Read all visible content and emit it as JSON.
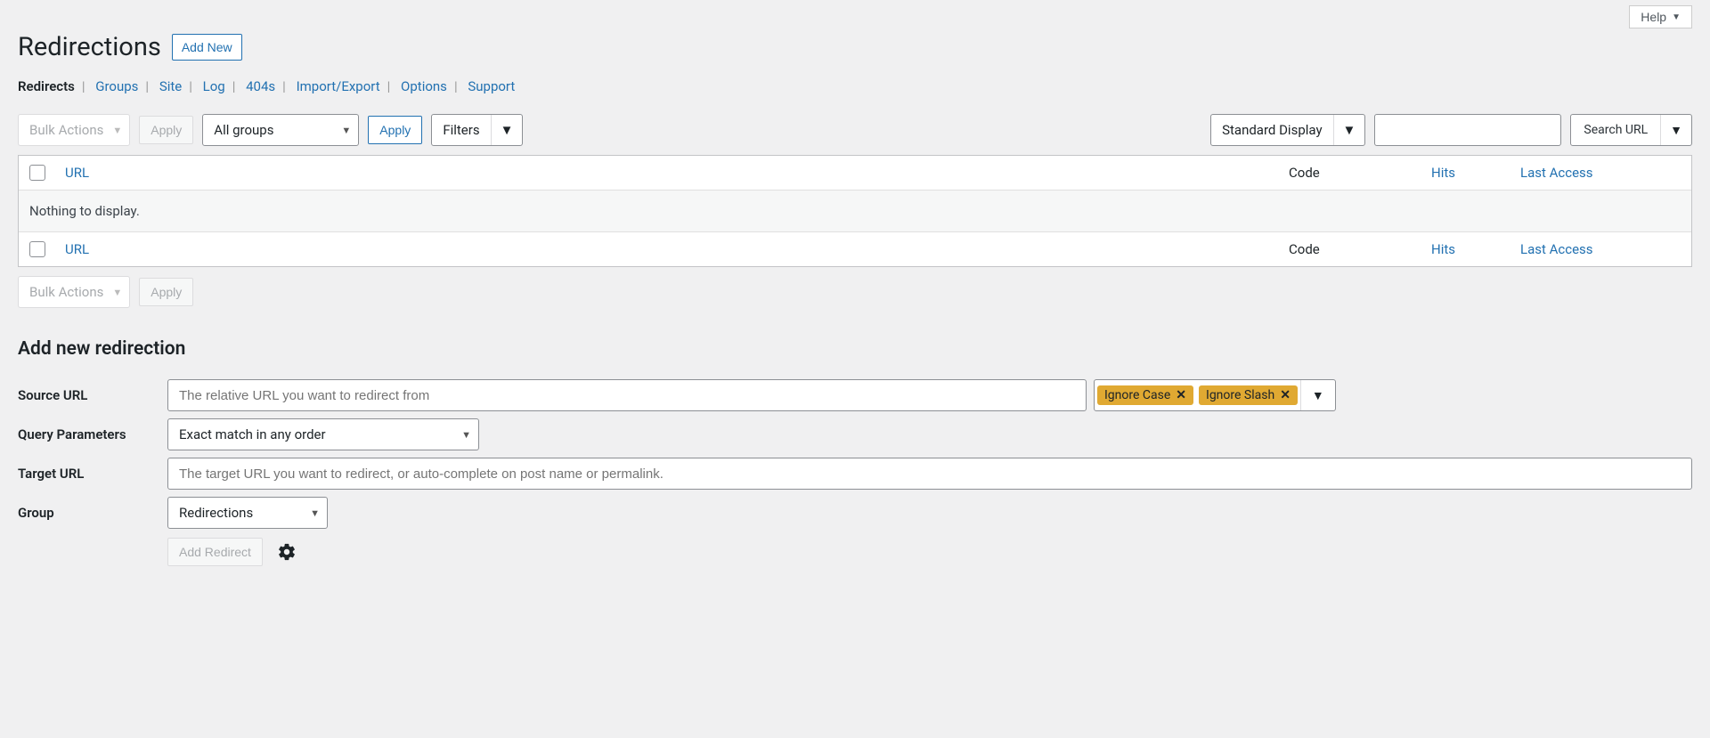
{
  "header": {
    "help_label": "Help",
    "page_title": "Redirections",
    "add_new_label": "Add New"
  },
  "nav": {
    "tabs": [
      "Redirects",
      "Groups",
      "Site",
      "Log",
      "404s",
      "Import/Export",
      "Options",
      "Support"
    ],
    "active": "Redirects"
  },
  "toolbar": {
    "bulk_actions_label": "Bulk Actions",
    "apply_label": "Apply",
    "all_groups_label": "All groups",
    "filters_label": "Filters",
    "standard_display_label": "Standard Display",
    "search_url_label": "Search URL"
  },
  "table": {
    "columns": {
      "url": "URL",
      "code": "Code",
      "hits": "Hits",
      "last_access": "Last Access"
    },
    "empty_message": "Nothing to display."
  },
  "add_form": {
    "heading": "Add new redirection",
    "source_label": "Source URL",
    "source_placeholder": "The relative URL you want to redirect from",
    "flags": {
      "ignore_case": "Ignore Case",
      "ignore_slash": "Ignore Slash"
    },
    "query_label": "Query Parameters",
    "query_value": "Exact match in any order",
    "target_label": "Target URL",
    "target_placeholder": "The target URL you want to redirect, or auto-complete on post name or permalink.",
    "group_label": "Group",
    "group_value": "Redirections",
    "submit_label": "Add Redirect"
  }
}
